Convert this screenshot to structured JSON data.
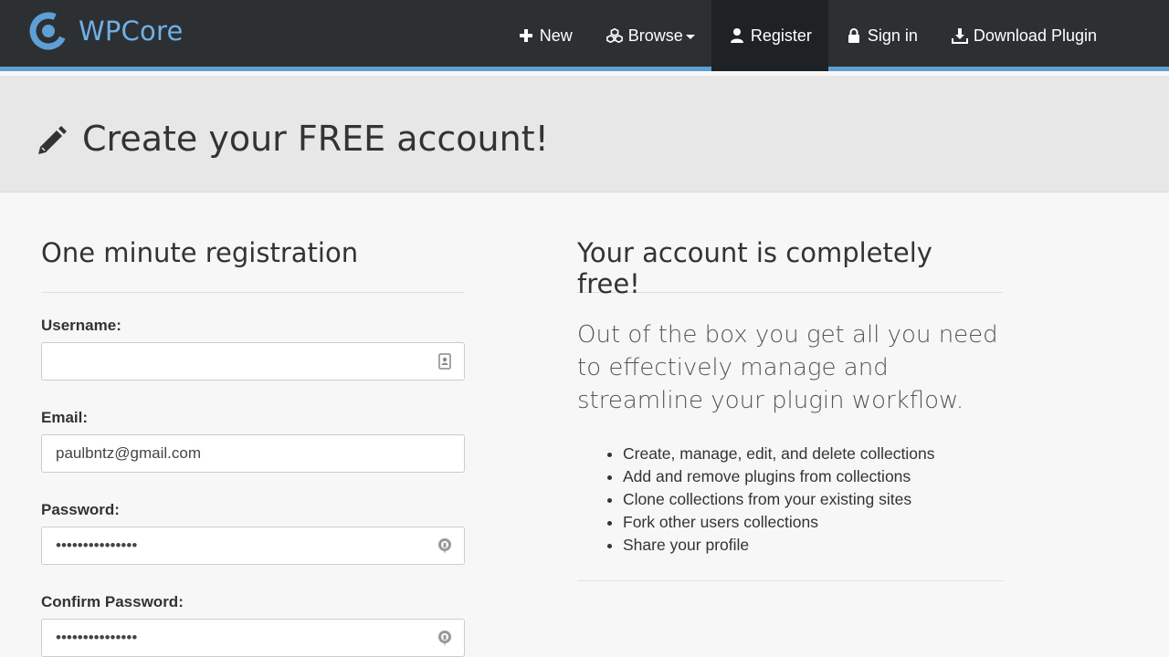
{
  "brand": {
    "name": "WPCore"
  },
  "nav": {
    "new": "New",
    "browse": "Browse",
    "register": "Register",
    "sign_in": "Sign in",
    "download": "Download Plugin"
  },
  "page": {
    "title": "Create your FREE account!"
  },
  "registration": {
    "heading": "One minute registration",
    "username_label": "Username:",
    "username_value": "",
    "email_label": "Email:",
    "email_value": "paulbntz@gmail.com",
    "password_label": "Password:",
    "password_value": "•••••••••••••••",
    "confirm_label": "Confirm Password:",
    "confirm_value": "•••••••••••••••"
  },
  "info": {
    "heading": "Your account is completely free!",
    "lead": "Out of the box you get all you need to effectively manage and streamline your plugin workflow.",
    "features": [
      "Create, manage, edit, and delete collections",
      "Add and remove plugins from collections",
      "Clone collections from your existing sites",
      "Fork other users collections",
      "Share your profile"
    ]
  },
  "colors": {
    "navbar": "#2d3033",
    "accent": "#5ea0d6",
    "brand": "#6fb0e6"
  }
}
